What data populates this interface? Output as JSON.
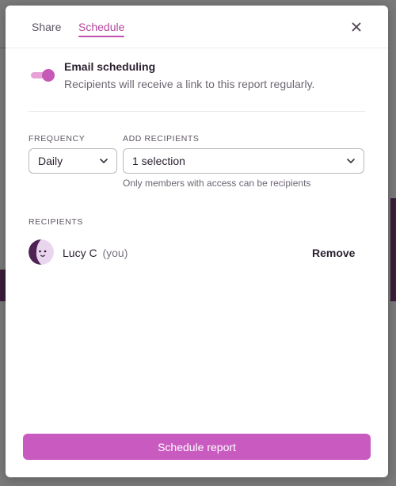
{
  "modal": {
    "tabs": [
      {
        "label": "Share",
        "active": false
      },
      {
        "label": "Schedule",
        "active": true
      }
    ],
    "close_icon": "close-icon"
  },
  "email_scheduling": {
    "enabled": true,
    "title": "Email scheduling",
    "description": "Recipients will receive a link to this report regularly."
  },
  "frequency": {
    "label": "FREQUENCY",
    "value": "Daily"
  },
  "add_recipients": {
    "label": "ADD RECIPIENTS",
    "value": "1 selection",
    "hint": "Only members with access can be recipients"
  },
  "recipients": {
    "label": "RECIPIENTS",
    "items": [
      {
        "name": "Lucy C",
        "suffix": "(you)",
        "action": "Remove"
      }
    ]
  },
  "submit": {
    "label": "Schedule report"
  },
  "colors": {
    "accent": "#c95ac0",
    "toggle_track": "#e7a3d8",
    "tab_active": "#b4479d"
  }
}
